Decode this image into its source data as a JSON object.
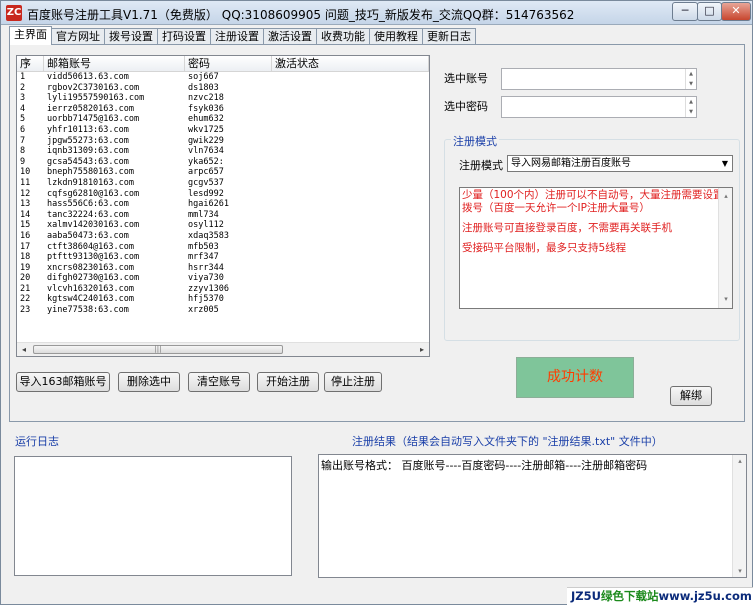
{
  "window": {
    "title": "百度账号注册工具V1.71（免费版） QQ:3108609905 问题_技巧_新版发布_交流QQ群：514763562",
    "icon_text": "ZC",
    "min_label": "─",
    "max_label": "□",
    "close_label": "✕"
  },
  "tabs": [
    {
      "label": "主界面"
    },
    {
      "label": "官方网址"
    },
    {
      "label": "拨号设置"
    },
    {
      "label": "打码设置"
    },
    {
      "label": "注册设置"
    },
    {
      "label": "激活设置"
    },
    {
      "label": "收费功能"
    },
    {
      "label": "使用教程"
    },
    {
      "label": "更新日志"
    }
  ],
  "account_table": {
    "columns": [
      "序",
      "邮箱账号",
      "密码",
      "激活状态"
    ],
    "rows": [
      [
        "1",
        "vidd50613.63.com",
        "soj667",
        ""
      ],
      [
        "2",
        "rgbov2C3730163.com",
        "ds1803",
        ""
      ],
      [
        "3",
        "lyli19557590163.com",
        "nzvc218",
        ""
      ],
      [
        "4",
        "ierrz05820163.com",
        "fsyk036",
        ""
      ],
      [
        "5",
        "uorbb71475@163.com",
        "ehum632",
        ""
      ],
      [
        "6",
        "yhfr10113:63.com",
        "wkv1725",
        ""
      ],
      [
        "7",
        "jpgw55273:63.com",
        "gwik229",
        ""
      ],
      [
        "8",
        "iqnb31309:63.com",
        "vln7634",
        ""
      ],
      [
        "9",
        "gcsa54543:63.com",
        "yka652:",
        ""
      ],
      [
        "10",
        "bneph75580163.com",
        "arpc657",
        ""
      ],
      [
        "11",
        "lzkdn91810163.com",
        "gcgv537",
        ""
      ],
      [
        "12",
        "cqfsg62810@163.com",
        "lesd992",
        ""
      ],
      [
        "13",
        "hass556C6:63.com",
        "hgai6261",
        ""
      ],
      [
        "14",
        "tanc32224:63.com",
        "mml734",
        ""
      ],
      [
        "15",
        "xalmv142030163.com",
        "osyl112",
        ""
      ],
      [
        "16",
        "aaba50473:63.com",
        "xdaq3583",
        ""
      ],
      [
        "17",
        "ctft38604@163.com",
        "mfb503",
        ""
      ],
      [
        "18",
        "ptftt93130@163.com",
        "mrf347",
        ""
      ],
      [
        "19",
        "xncrs08230163.com",
        "hsrr344",
        ""
      ],
      [
        "20",
        "difgh02730@163.com",
        "viya730",
        ""
      ],
      [
        "21",
        "vlcvh16320163.com",
        "zzyv1306",
        ""
      ],
      [
        "22",
        "kgtsw4C240163.com",
        "hfj5370",
        ""
      ],
      [
        "23",
        "yine77538:63.com",
        "xrz005",
        ""
      ]
    ]
  },
  "scroll": {
    "left": "◂",
    "right": "▸",
    "grip": "|||",
    "up": "▴",
    "down": "▾"
  },
  "buttons": {
    "import": "导入163邮箱账号",
    "delete": "删除选中",
    "clear": "清空账号",
    "start": "开始注册",
    "stop": "停止注册",
    "unbind": "解绑"
  },
  "fields": {
    "selected_account_label": "选中账号",
    "selected_account_value": "",
    "selected_password_label": "选中密码",
    "selected_password_value": ""
  },
  "register_mode": {
    "group_title": "注册模式",
    "mode_label": "注册模式",
    "mode_value": "导入网易邮箱注册百度账号",
    "notes": [
      "少量（100个内）注册可以不自动号，大量注册需要设置拨号（百度一天允许一个IP注册大量号）",
      "注册账号可直接登录百度，不需要再关联手机",
      "受接码平台限制，最多只支持5线程"
    ]
  },
  "success_label": "成功计数",
  "log": {
    "label": "运行日志"
  },
  "result": {
    "label": "注册结果（结果会自动写入文件夹下的 \"注册结果.txt\" 文件中）",
    "content": "输出账号格式： 百度账号----百度密码----注册邮箱----注册邮箱密码"
  },
  "watermark": {
    "prefix": "JZ5U",
    "green": "绿色下载站",
    "suffix": "www.jz5u.com"
  }
}
